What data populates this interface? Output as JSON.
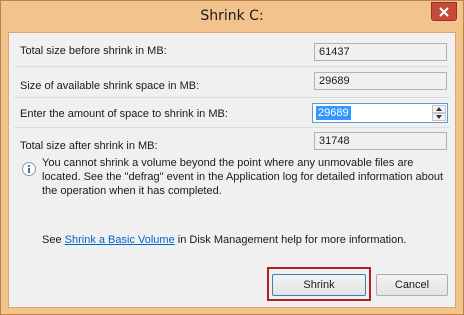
{
  "window": {
    "title": "Shrink C:",
    "close_icon": "close-icon"
  },
  "rows": [
    {
      "label": "Total size before shrink in MB:",
      "value": "61437"
    },
    {
      "label": "Size of available shrink space in MB:",
      "value": "29689"
    },
    {
      "label": "Enter the amount of space to shrink in MB:",
      "value": "29689"
    },
    {
      "label": "Total size after shrink in MB:",
      "value": "31748"
    }
  ],
  "info": {
    "icon": "info-icon",
    "text": "You cannot shrink a volume beyond the point where any unmovable files are located. See the \"defrag\" event in the Application log for detailed information about the operation when it has completed."
  },
  "help": {
    "prefix": "See ",
    "link": "Shrink a Basic Volume",
    "suffix": " in Disk Management help for more information."
  },
  "buttons": {
    "shrink": "Shrink",
    "cancel": "Cancel"
  },
  "colors": {
    "title_bar": "#f3c38e",
    "close_button": "#c74b3c",
    "highlight": "#b02025",
    "link": "#0066cc"
  }
}
